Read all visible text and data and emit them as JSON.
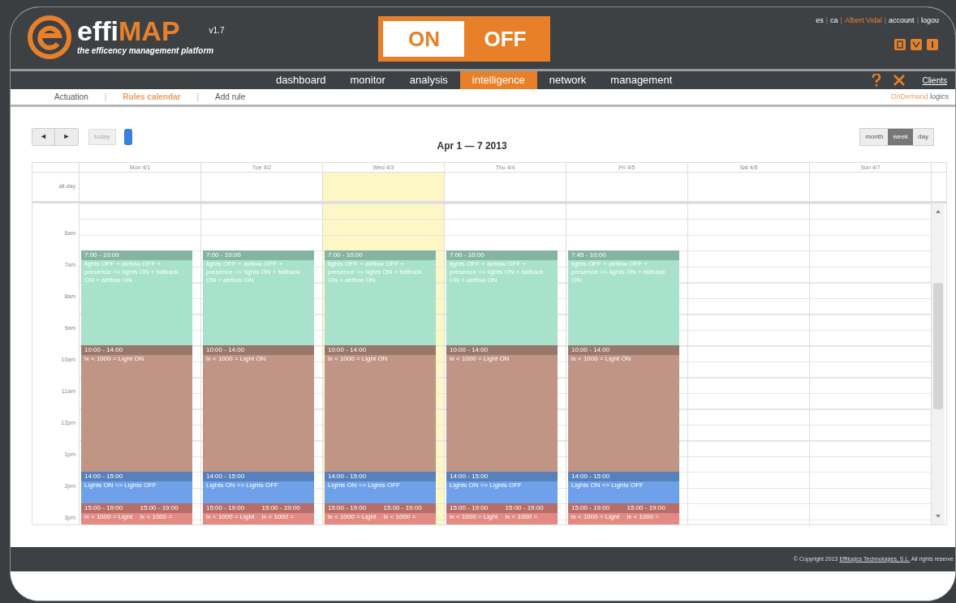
{
  "header": {
    "brand_a": "effi",
    "brand_b": "MAP",
    "version": "v1.7",
    "tagline": "the efficency management platform",
    "power": [
      {
        "label": "ON",
        "selected": false
      },
      {
        "label": "OFF",
        "selected": true
      }
    ],
    "separator": "|",
    "links": [
      {
        "label": "es",
        "kind": "plain"
      },
      {
        "label": "ca",
        "kind": "plain"
      },
      {
        "label": "Albert Vidal",
        "kind": "user"
      },
      {
        "label": "account",
        "kind": "plain"
      },
      {
        "label": "logou",
        "kind": "plain"
      }
    ]
  },
  "nav": {
    "items": [
      {
        "label": "dashboard",
        "selected": false
      },
      {
        "label": "monitor",
        "selected": false
      },
      {
        "label": "analysis",
        "selected": false
      },
      {
        "label": "intelligence",
        "selected": true
      },
      {
        "label": "network",
        "selected": false
      },
      {
        "label": "management",
        "selected": false
      }
    ],
    "clients": "Clients"
  },
  "subnav": {
    "items": [
      {
        "label": "Actuation",
        "selected": false
      },
      {
        "label": "Rules calendar",
        "selected": true
      },
      {
        "label": "Add rule",
        "selected": false
      }
    ],
    "separator": "|",
    "right_a": "OnDemand",
    "right_b": "logics"
  },
  "toolbar": {
    "prev": "◄",
    "next": "►",
    "today": "today",
    "title": "Apr 1 — 7 2013",
    "views": [
      {
        "label": "month",
        "selected": false
      },
      {
        "label": "week",
        "selected": true
      },
      {
        "label": "day",
        "selected": false
      }
    ]
  },
  "calendar": {
    "allday": "all-day",
    "hours": [
      "6am",
      "7am",
      "8am",
      "9am",
      "10am",
      "11am",
      "12pm",
      "1pm",
      "2pm",
      "3pm"
    ],
    "days": [
      {
        "label": "Mon 4/1",
        "today": false,
        "events": [
          {
            "kind": "morning",
            "color": "#a8e2cc",
            "time": "7:00 - 10:00",
            "text": "lights OFF + airflow OFF + presence => lights ON + fallback ON + airflow ON"
          },
          {
            "kind": "midday",
            "color": "#c09586",
            "time": "10:00 - 14:00",
            "text": "lx < 1000 = Light ON"
          },
          {
            "kind": "switch",
            "color": "#6fa1ea",
            "time": "14:00 - 15:00",
            "text": "Lights ON => Lights OFF"
          },
          {
            "kind": "evening_a",
            "color": "#e38a84",
            "time": "15:00 - 19:00",
            "text": "lx < 1000 = Light"
          },
          {
            "kind": "evening_b",
            "color": "#e38a84",
            "time": "15:00 - 19:00",
            "text": "lx < 1000 ="
          }
        ]
      },
      {
        "label": "Tue 4/2",
        "today": false,
        "events": [
          {
            "kind": "morning",
            "color": "#a8e2cc",
            "time": "7:00 - 10:00",
            "text": "lights OFF + airflow OFF + presence => lights ON + fallback ON + airflow ON"
          },
          {
            "kind": "midday",
            "color": "#c09586",
            "time": "10:00 - 14:00",
            "text": "lx < 1000 = Light ON"
          },
          {
            "kind": "switch",
            "color": "#6fa1ea",
            "time": "14:00 - 15:00",
            "text": "Lights ON => Lights OFF"
          },
          {
            "kind": "evening_a",
            "color": "#e38a84",
            "time": "15:00 - 19:00",
            "text": "lx < 1000 = Light"
          },
          {
            "kind": "evening_b",
            "color": "#e38a84",
            "time": "15:00 - 19:00",
            "text": "lx < 1000 ="
          }
        ]
      },
      {
        "label": "Wed 4/3",
        "today": true,
        "events": [
          {
            "kind": "morning",
            "color": "#a8e2cc",
            "time": "7:00 - 10:00",
            "text": "lights OFF + airflow OFF + presence => lights ON + fallback ON + airflow ON"
          },
          {
            "kind": "midday",
            "color": "#c09586",
            "time": "10:00 - 14:00",
            "text": "lx < 1000 = Light ON"
          },
          {
            "kind": "switch",
            "color": "#6fa1ea",
            "time": "14:00 - 15:00",
            "text": "Lights ON => Lights OFF"
          },
          {
            "kind": "evening_a",
            "color": "#e38a84",
            "time": "15:00 - 19:00",
            "text": "lx < 1000 = Light"
          },
          {
            "kind": "evening_b",
            "color": "#e38a84",
            "time": "15:00 - 19:00",
            "text": "lx < 1000 ="
          }
        ]
      },
      {
        "label": "Thu 4/4",
        "today": false,
        "events": [
          {
            "kind": "morning",
            "color": "#a8e2cc",
            "time": "7:00 - 10:00",
            "text": "lights OFF + airflow OFF + presence => lights ON + fallback ON + airflow ON"
          },
          {
            "kind": "midday",
            "color": "#c09586",
            "time": "10:00 - 14:00",
            "text": "lx < 1000 = Light ON"
          },
          {
            "kind": "switch",
            "color": "#6fa1ea",
            "time": "14:00 - 15:00",
            "text": "Lights ON => Lights OFF"
          },
          {
            "kind": "evening_a",
            "color": "#e38a84",
            "time": "15:00 - 19:00",
            "text": "lx < 1000 = Light"
          },
          {
            "kind": "evening_b",
            "color": "#e38a84",
            "time": "15:00 - 19:00",
            "text": "lx < 1000 ="
          }
        ]
      },
      {
        "label": "Fri 4/5",
        "today": false,
        "events": [
          {
            "kind": "morning",
            "color": "#a8e2cc",
            "time": "7:45 - 10:00",
            "text": "lights OFF + airflow OFF + presence => lights ON + fallback ON"
          },
          {
            "kind": "midday",
            "color": "#c09586",
            "time": "10:00 - 14:00",
            "text": "lx < 1000 = Light ON"
          },
          {
            "kind": "switch",
            "color": "#6fa1ea",
            "time": "14:00 - 15:00",
            "text": "Lights ON => Lights OFF"
          },
          {
            "kind": "evening_a",
            "color": "#e38a84",
            "time": "15:00 - 19:00",
            "text": "lx < 1000 = Light"
          },
          {
            "kind": "evening_b",
            "color": "#e38a84",
            "time": "15:00 - 19:00",
            "text": "lx < 1000 ="
          }
        ]
      },
      {
        "label": "Sat 4/6",
        "today": false
      },
      {
        "label": "Sun 4/7",
        "today": false
      }
    ]
  },
  "footer": {
    "prefix": "© Copyright 2013",
    "link": "Effilogics Technologies, S.L.",
    "suffix": "All rights reserve"
  }
}
